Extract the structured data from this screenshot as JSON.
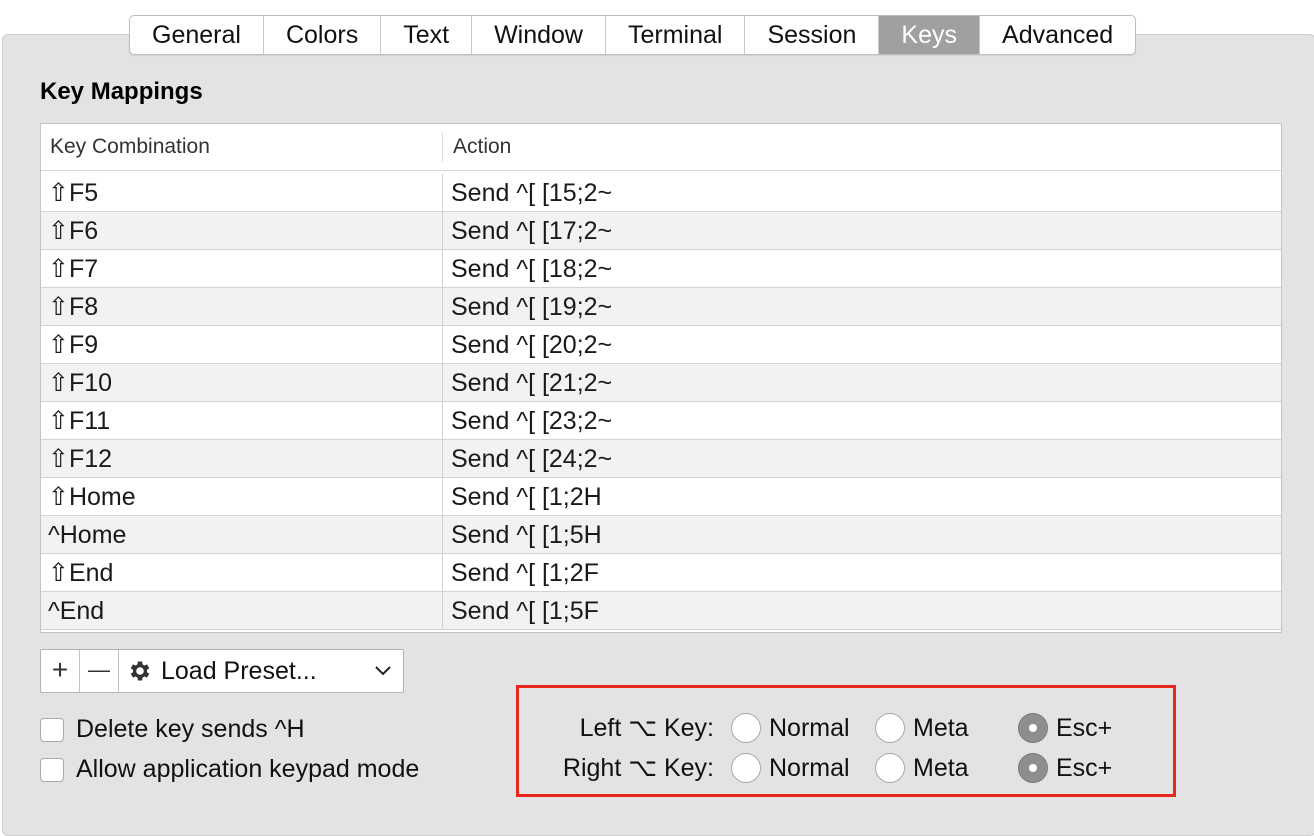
{
  "tabs": [
    {
      "label": "General"
    },
    {
      "label": "Colors"
    },
    {
      "label": "Text"
    },
    {
      "label": "Window"
    },
    {
      "label": "Terminal"
    },
    {
      "label": "Session"
    },
    {
      "label": "Keys",
      "selected": true
    },
    {
      "label": "Advanced"
    }
  ],
  "section_title": "Key Mappings",
  "table": {
    "columns": [
      "Key Combination",
      "Action"
    ],
    "rows": [
      {
        "key": "⇧F5",
        "action": "Send ^[ [15;2~"
      },
      {
        "key": "⇧F6",
        "action": "Send ^[ [17;2~"
      },
      {
        "key": "⇧F7",
        "action": "Send ^[ [18;2~"
      },
      {
        "key": "⇧F8",
        "action": "Send ^[ [19;2~"
      },
      {
        "key": "⇧F9",
        "action": "Send ^[ [20;2~"
      },
      {
        "key": "⇧F10",
        "action": "Send ^[ [21;2~"
      },
      {
        "key": "⇧F11",
        "action": "Send ^[ [23;2~"
      },
      {
        "key": "⇧F12",
        "action": "Send ^[ [24;2~"
      },
      {
        "key": "⇧Home",
        "action": "Send ^[ [1;2H"
      },
      {
        "key": "^Home",
        "action": "Send ^[ [1;5H"
      },
      {
        "key": "⇧End",
        "action": "Send ^[ [1;2F"
      },
      {
        "key": "^End",
        "action": "Send ^[ [1;5F"
      }
    ]
  },
  "toolbar": {
    "add": "+",
    "remove": "—",
    "preset_label": "Load Preset...",
    "preset_icon": "gear-icon"
  },
  "checkboxes": [
    {
      "label": "Delete key sends ^H",
      "checked": false
    },
    {
      "label": "Allow application keypad mode",
      "checked": false
    }
  ],
  "option_keys": [
    {
      "label": "Left ⌥ Key:",
      "options": [
        "Normal",
        "Meta",
        "Esc+"
      ],
      "selected": "Esc+"
    },
    {
      "label": "Right ⌥ Key:",
      "options": [
        "Normal",
        "Meta",
        "Esc+"
      ],
      "selected": "Esc+"
    }
  ],
  "colors": {
    "highlight_border": "#e8281f",
    "selected_tab": "#a0a0a0"
  }
}
